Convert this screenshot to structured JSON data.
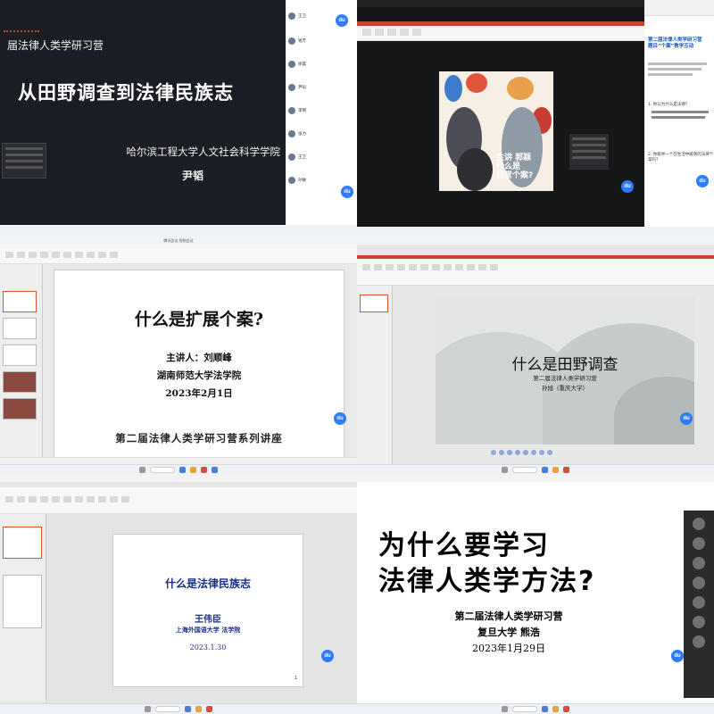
{
  "window": {
    "title": "腾讯会议 视频会议"
  },
  "panes": {
    "p1": {
      "title_partial": "届法律人类学研习营",
      "main_title": "从田野调查到法律民族志",
      "institution": "哈尔滨工程大学人文社会科学学院",
      "speaker": "尹韬",
      "participants": [
        "王卫",
        "钱芳",
        "徐晨",
        "尹韬",
        "李明",
        "张力",
        "王卫",
        "孙敏"
      ]
    },
    "p2": {
      "art_text": "主讲 郭颖\n什么是\n日常个案?",
      "web_title": "第二届法律人类学研习营\n题目“个案”教学互动",
      "questions": [
        "1. 你认为什么是法律？",
        "2. 你能举一个在生活中碰到的法律个案吗？"
      ]
    },
    "p3": {
      "title": "什么是扩展个案?",
      "speaker": "主讲人：刘顺峰",
      "institution": "湖南师范大学法学院",
      "date": "2023年2月1日",
      "series": "第二届法律人类学研习营系列讲座"
    },
    "p4": {
      "title": "什么是田野调查",
      "subtitle": "第二届法律人类学研习营",
      "speaker": "孙旭（重庆大学）"
    },
    "p5": {
      "title": "什么是法律民族志",
      "speaker": "王伟臣",
      "institution": "上海外国语大学 法学院",
      "date": "2023.1.30",
      "page": "1"
    },
    "p6": {
      "title_line1": "为什么要学习",
      "title_line2": "法律人类学方法?",
      "subtitle": "第二届法律人类学研习营",
      "speaker": "复旦大学 熊浩",
      "date": "2023年1月29日"
    }
  },
  "icons": {
    "meeting_assistant": "du"
  }
}
